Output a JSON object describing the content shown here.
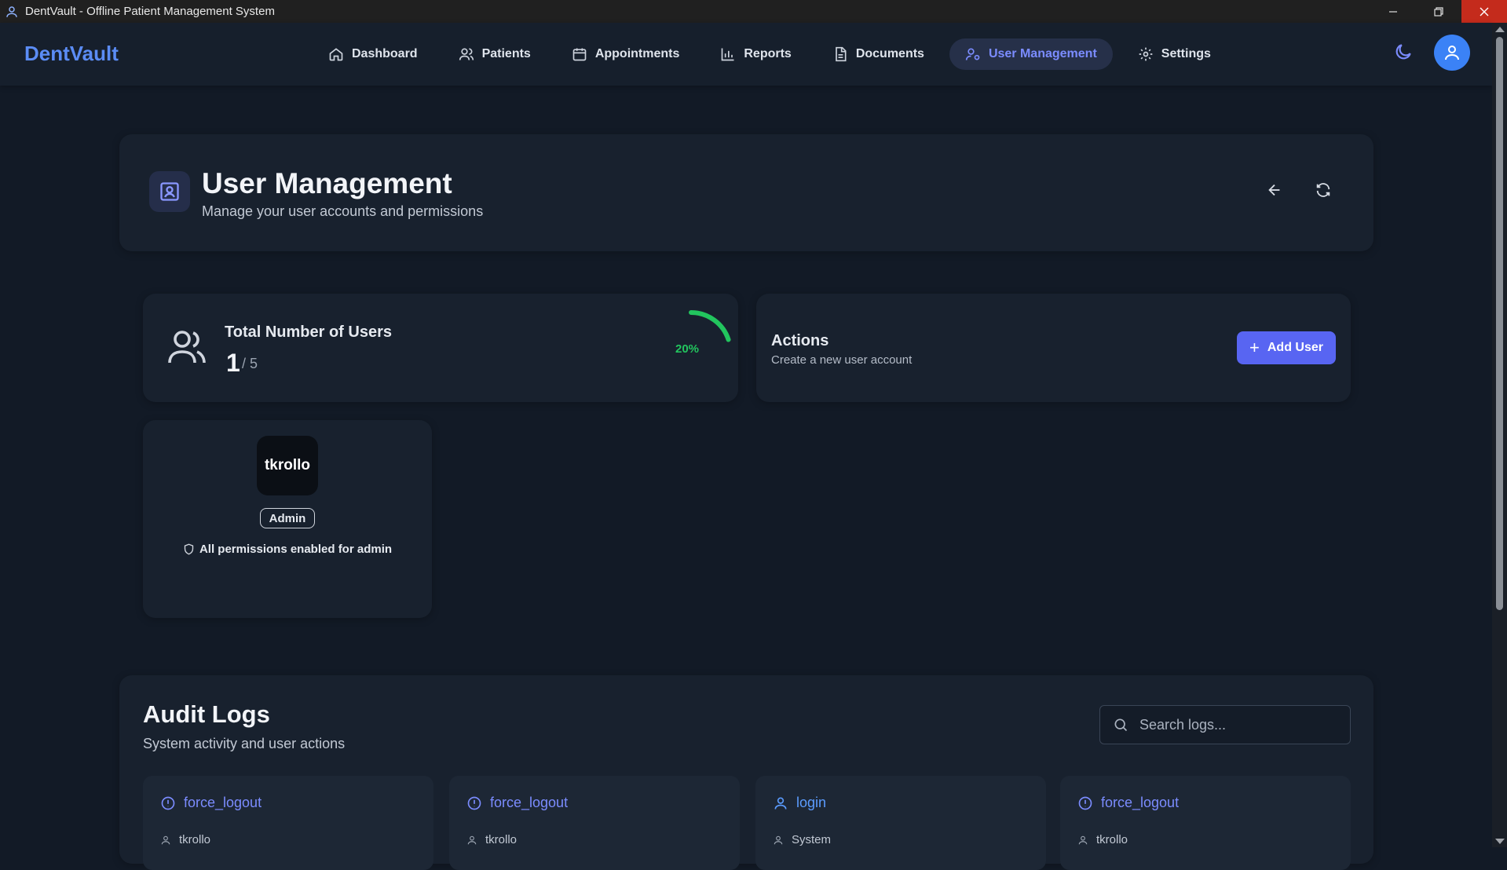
{
  "window": {
    "title": "DentVault - Offline Patient Management System"
  },
  "nav": {
    "brand": "DentVault",
    "items": [
      {
        "label": "Dashboard",
        "icon": "home-icon"
      },
      {
        "label": "Patients",
        "icon": "users-icon"
      },
      {
        "label": "Appointments",
        "icon": "calendar-icon"
      },
      {
        "label": "Reports",
        "icon": "bar-chart-icon"
      },
      {
        "label": "Documents",
        "icon": "document-icon"
      },
      {
        "label": "User Management",
        "icon": "user-cog-icon",
        "active": true
      },
      {
        "label": "Settings",
        "icon": "gear-icon"
      }
    ],
    "accent": "#7b8cff"
  },
  "header": {
    "title": "User Management",
    "subtitle": "Manage your user accounts and permissions"
  },
  "stats": {
    "label": "Total Number of Users",
    "value": "1",
    "max": "/ 5",
    "percent_label": "20%",
    "fraction": 0.2,
    "ring_color": "#22c55e"
  },
  "actions": {
    "title": "Actions",
    "subtitle": "Create a new user account",
    "add_user_label": "Add User",
    "button_color": "#5865f2"
  },
  "user": {
    "name": "tkrollo",
    "role": "Admin",
    "permission_note": "All permissions enabled for admin"
  },
  "audit": {
    "title": "Audit Logs",
    "subtitle": "System activity and user actions",
    "search_placeholder": "Search logs...",
    "logs": [
      {
        "action": "force_logout",
        "user": "tkrollo",
        "icon": "alert-circle-icon"
      },
      {
        "action": "force_logout",
        "user": "tkrollo",
        "icon": "alert-circle-icon"
      },
      {
        "action": "login",
        "user": "System",
        "icon": "user-icon"
      },
      {
        "action": "force_logout",
        "user": "tkrollo",
        "icon": "alert-circle-icon"
      }
    ]
  }
}
